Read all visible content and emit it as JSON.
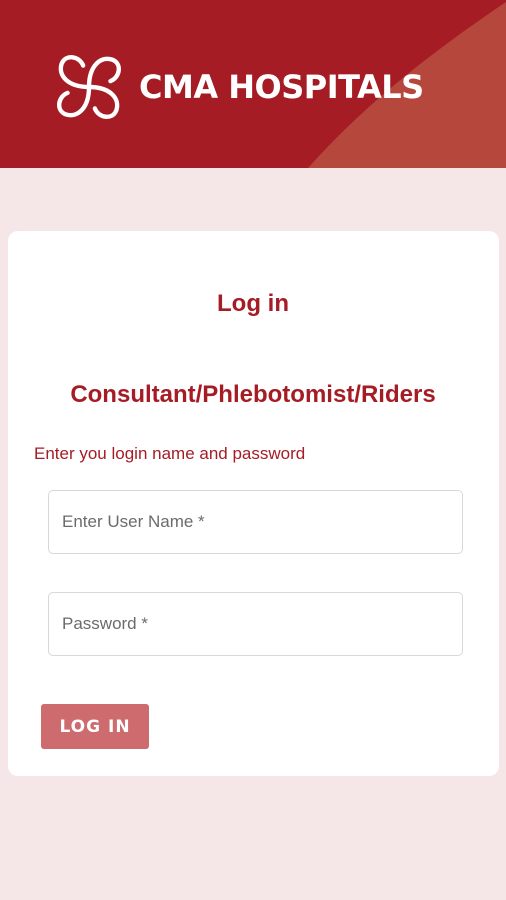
{
  "header": {
    "brand_name": "CMA HOSPITALS",
    "background_color": "#a51c24",
    "swoosh_color": "#b5473d"
  },
  "login": {
    "title": "Log in",
    "subtitle": "Consultant/Phlebotomist/Riders",
    "instruction": "Enter you login name and password",
    "username_placeholder": "Enter User Name *",
    "password_placeholder": "Password *",
    "button_label": "LOG IN",
    "accent_color": "#a51c24",
    "button_color": "#cd6b6e"
  },
  "page": {
    "background_color": "#f5e6e7"
  }
}
